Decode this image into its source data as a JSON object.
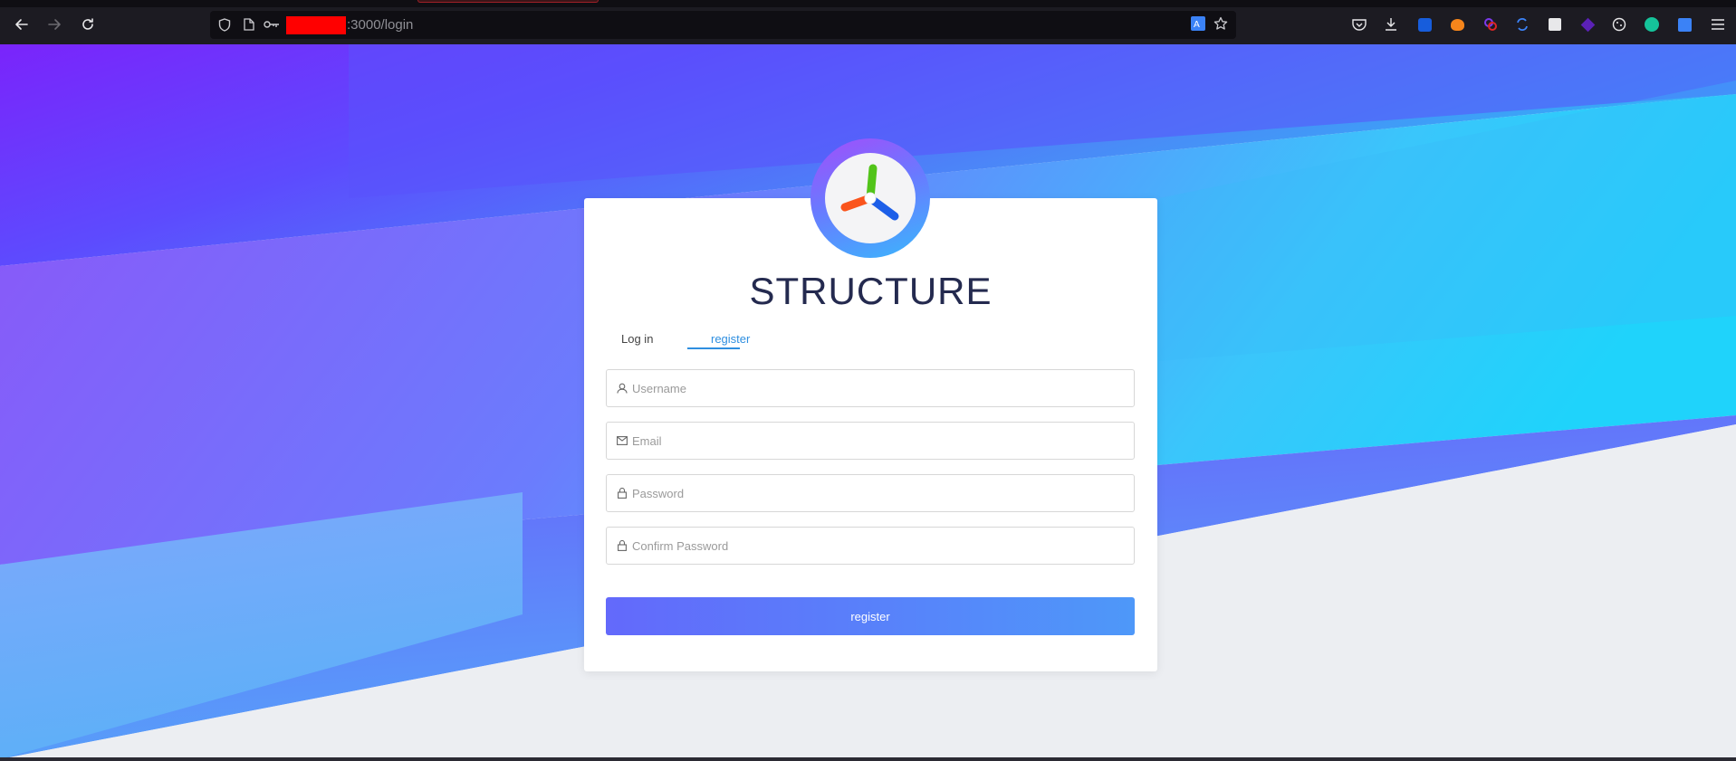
{
  "browser": {
    "url_suffix": ":3000/login",
    "icons": [
      "back-icon",
      "forward-icon",
      "reload-icon",
      "shield-icon",
      "page-icon",
      "key-icon",
      "translate-icon",
      "bookmark-star-icon",
      "pocket-icon",
      "download-icon",
      "extension-icons",
      "menu-icon"
    ]
  },
  "app": {
    "title": "STRUCTURE",
    "tabs": {
      "login": "Log in",
      "register": "register"
    },
    "active_tab": "register",
    "fields": {
      "username": {
        "placeholder": "Username",
        "value": ""
      },
      "email": {
        "placeholder": "Email",
        "value": ""
      },
      "password": {
        "placeholder": "Password",
        "value": ""
      },
      "confirm_password": {
        "placeholder": "Confirm Password",
        "value": ""
      }
    },
    "submit_label": "register"
  },
  "colors": {
    "accent": "#2f8fe0",
    "title": "#242a4f",
    "button_start": "#6369fb",
    "button_end": "#4e98f9"
  }
}
